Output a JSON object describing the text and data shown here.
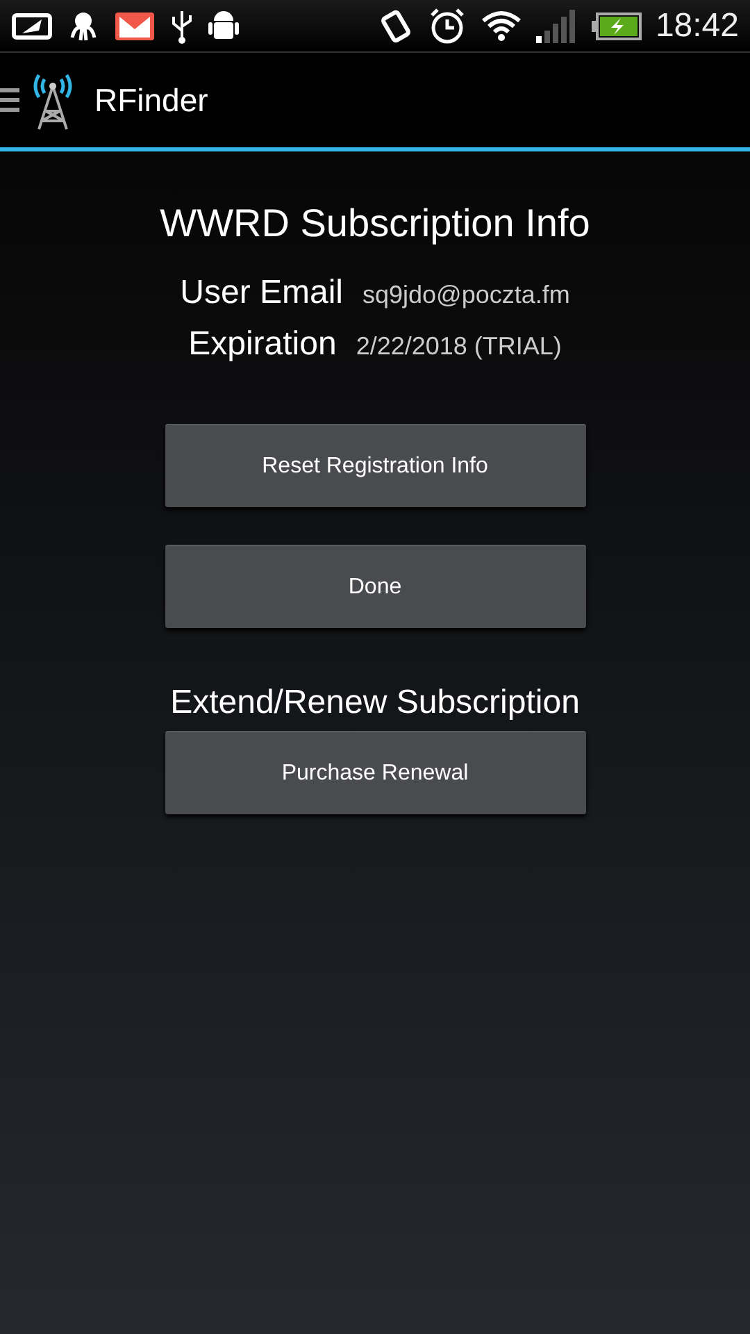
{
  "status_bar": {
    "time": "18:42"
  },
  "app_bar": {
    "title": "RFinder"
  },
  "heading": "WWRD Subscription Info",
  "info": [
    {
      "label": "User Email",
      "value": "sq9jdo@poczta.fm"
    },
    {
      "label": "Expiration",
      "value": "2/22/2018 (TRIAL)"
    }
  ],
  "buttons": [
    "Reset Registration Info",
    "Done"
  ],
  "renew": {
    "heading": "Extend/Renew Subscription",
    "button": "Purchase Renewal"
  }
}
